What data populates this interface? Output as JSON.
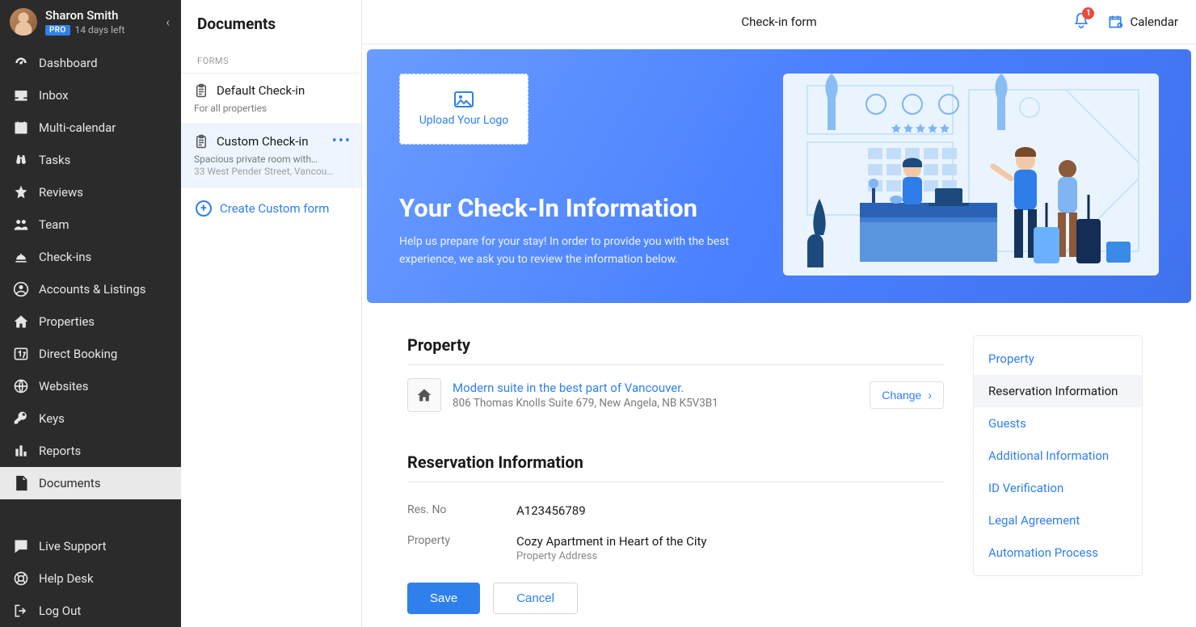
{
  "profile": {
    "name": "Sharon Smith",
    "badge": "PRO",
    "days_left": "14 days left"
  },
  "sidebar": {
    "items": [
      {
        "label": "Dashboard",
        "icon": "gauge-icon"
      },
      {
        "label": "Inbox",
        "icon": "tray-icon"
      },
      {
        "label": "Multi-calendar",
        "icon": "calendar-icon"
      },
      {
        "label": "Tasks",
        "icon": "binoculars-icon"
      },
      {
        "label": "Reviews",
        "icon": "star-icon"
      },
      {
        "label": "Team",
        "icon": "people-icon"
      },
      {
        "label": "Check-ins",
        "icon": "bell-service-icon"
      },
      {
        "label": "Accounts & Listings",
        "icon": "user-circle-icon"
      },
      {
        "label": "Properties",
        "icon": "home-icon"
      },
      {
        "label": "Direct Booking",
        "icon": "booking-icon"
      },
      {
        "label": "Websites",
        "icon": "globe-icon"
      },
      {
        "label": "Keys",
        "icon": "key-icon"
      },
      {
        "label": "Reports",
        "icon": "bar-chart-icon"
      },
      {
        "label": "Documents",
        "icon": "file-icon"
      }
    ],
    "active": "Documents",
    "footer": [
      {
        "label": "Live Support",
        "icon": "chat-icon"
      },
      {
        "label": "Help Desk",
        "icon": "lifebuoy-icon"
      },
      {
        "label": "Log Out",
        "icon": "logout-icon"
      }
    ]
  },
  "panel": {
    "title": "Documents",
    "section_label": "FORMS",
    "forms": [
      {
        "name": "Default Check-in",
        "sub": "For all properties"
      },
      {
        "name": "Custom Check-in",
        "sub": "Spacious private room with…",
        "sub2": "33 West Pender Street, Vancou…"
      }
    ],
    "active_form_index": 1,
    "create_label": "Create Custom form"
  },
  "topbar": {
    "title": "Check-in form",
    "notification_count": "1",
    "calendar_label": "Calendar"
  },
  "hero": {
    "upload_label": "Upload Your Logo",
    "title": "Your Check-In Information",
    "subtitle": "Help us prepare for your stay!  In order to provide you with the best experience, we ask you to review the information below."
  },
  "sections": {
    "property_title": "Property",
    "property": {
      "name": "Modern suite in the best part of Vancouver.",
      "address": "806 Thomas Knolls Suite 679, New Angela, NB K5V3B1",
      "change_label": "Change"
    },
    "reservation_title": "Reservation Information",
    "kv": [
      {
        "label": "Res. No",
        "value": "A123456789"
      },
      {
        "label": "Property",
        "value": "Cozy Apartment in Heart of the City",
        "sub": "Property Address"
      }
    ]
  },
  "rail": {
    "items": [
      "Property",
      "Reservation Information",
      "Guests",
      "Additional Information",
      "ID Verification",
      "Legal Agreement",
      "Automation Process"
    ],
    "active_index": 1
  },
  "actions": {
    "save": "Save",
    "cancel": "Cancel"
  }
}
